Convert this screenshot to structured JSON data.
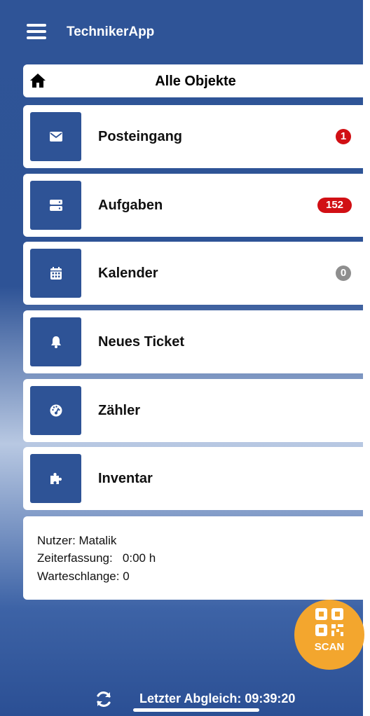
{
  "header": {
    "app_title": "TechnikerApp",
    "menu_icon": "hamburger-menu-icon"
  },
  "objects_bar": {
    "title": "Alle Objekte",
    "icon": "home-icon"
  },
  "menu": [
    {
      "label": "Posteingang",
      "icon": "envelope-icon",
      "badge": "1",
      "badge_color": "#d10f14"
    },
    {
      "label": "Aufgaben",
      "icon": "tasks-icon",
      "badge": "152",
      "badge_color": "#d10f14"
    },
    {
      "label": "Kalender",
      "icon": "calendar-icon",
      "badge": "0",
      "badge_color": "#8e8e8e"
    },
    {
      "label": "Neues Ticket",
      "icon": "bell-icon",
      "badge": ""
    },
    {
      "label": "Zähler",
      "icon": "gauge-icon",
      "badge": ""
    },
    {
      "label": "Inventar",
      "icon": "puzzle-icon",
      "badge": ""
    }
  ],
  "info": {
    "user": "Nutzer: Matalik",
    "time_tracking": "Zeiterfassung:   0:00 h",
    "queue": "Warteschlange: 0"
  },
  "scan_button": {
    "label": "SCAN",
    "icon": "qr-code-icon",
    "color": "#f3a62e"
  },
  "footer": {
    "sync_text": "Letzter Abgleich: 09:39:20",
    "sync_icon": "sync-icon"
  },
  "colors": {
    "primary": "#2e5396",
    "accent": "#f3a62e",
    "badge_red": "#d10f14",
    "badge_grey": "#8e8e8e"
  }
}
